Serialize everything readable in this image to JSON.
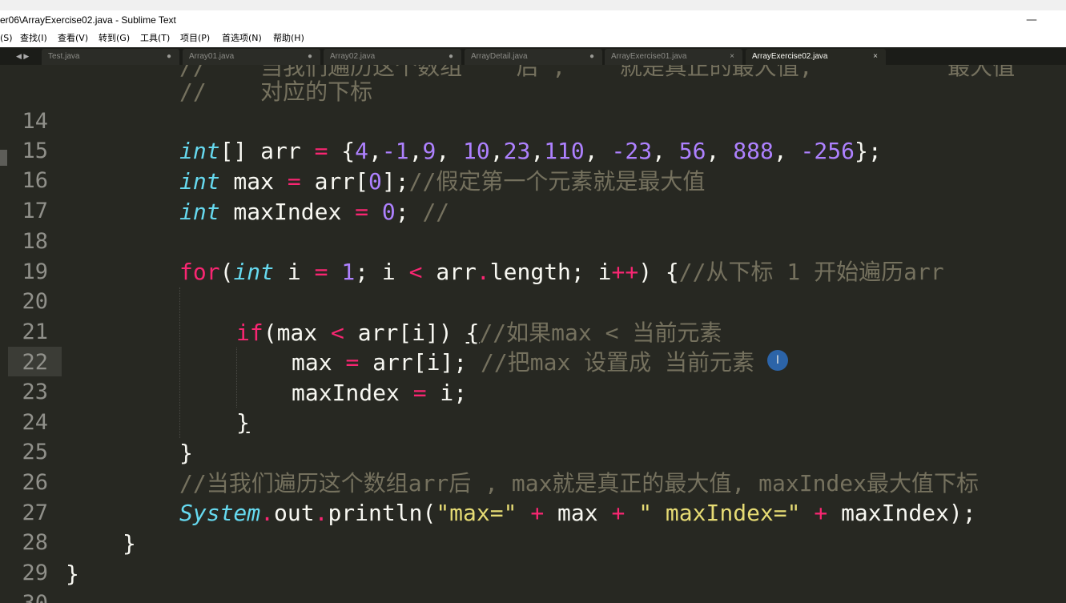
{
  "window": {
    "title": "er06\\ArrayExercise02.java - Sublime Text",
    "minimize_glyph": "—"
  },
  "menu": [
    "(S)",
    "查找(I)",
    "查看(V)",
    "转到(G)",
    "工具(T)",
    "项目(P)",
    "首选项(N)",
    "帮助(H)"
  ],
  "tabs": [
    {
      "label": "Test.java",
      "close": "●",
      "active": false
    },
    {
      "label": "Array01.java",
      "close": "●",
      "active": false
    },
    {
      "label": "Array02.java",
      "close": "●",
      "active": false
    },
    {
      "label": "ArrayDetail.java",
      "close": "●",
      "active": false
    },
    {
      "label": "ArrayExercise01.java",
      "close": "×",
      "active": false
    },
    {
      "label": "ArrayExercise02.java",
      "close": "×",
      "active": true
    }
  ],
  "tab_nav": "◀ ▶",
  "editor": {
    "current_line": "23",
    "lines": [
      {
        "n": "",
        "text": "//    当我们遍历这个数组    后 ,    就是真正的最大值,          最大值"
      },
      {
        "n": "14",
        "text": "//    对应的下标"
      },
      {
        "n": "15",
        "text": ""
      },
      {
        "n": "16",
        "text": "int[] arr = {4,-1,9, 10,23,110, -23, 56, 888, -256};"
      },
      {
        "n": "17",
        "text": "int max = arr[0];//假定第一个元素就是最大值"
      },
      {
        "n": "18",
        "text": "int maxIndex = 0; //"
      },
      {
        "n": "19",
        "text": ""
      },
      {
        "n": "20",
        "text": "for(int i = 1; i < arr.length; i++) {//从下标 1 开始遍历arr"
      },
      {
        "n": "21",
        "text": ""
      },
      {
        "n": "22",
        "text": "if(max < arr[i]) {//如果max < 当前元素"
      },
      {
        "n": "23",
        "text": "max = arr[i]; //把max 设置成 当前元素"
      },
      {
        "n": "24",
        "text": "maxIndex = i;"
      },
      {
        "n": "25",
        "text": "}"
      },
      {
        "n": "26",
        "text": "}"
      },
      {
        "n": "27",
        "text": "//当我们遍历这个数组arr后 , max就是真正的最大值, maxIndex最大值下标"
      },
      {
        "n": "28",
        "text": "System.out.println(\"max=\" + max + \" maxIndex=\" + maxIndex);"
      },
      {
        "n": "29",
        "text": "}"
      },
      {
        "n": "30",
        "text": "}"
      }
    ]
  },
  "colors": {
    "background": "#272822",
    "keyword": "#f92672",
    "type": "#66d9ef",
    "number": "#ae81ff",
    "string": "#e6db74",
    "comment": "#75715e",
    "text": "#f8f8f2"
  },
  "icons": {
    "text_cursor": "I"
  }
}
